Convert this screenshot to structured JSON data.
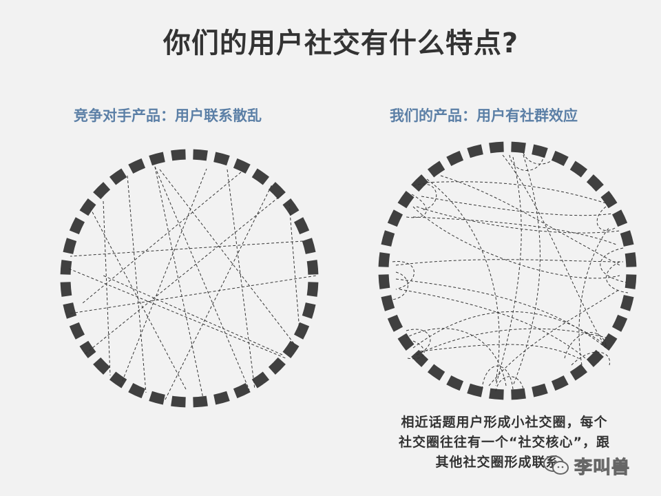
{
  "title": "你们的用户社交有什么特点?",
  "left": {
    "heading": "竞争对手产品：用户联系散乱"
  },
  "right": {
    "heading": "我们的产品：用户有社群效应",
    "caption": "相近话题用户形成小社交圈，每个社交圈往往有一个“社交核心”，跟其他社交圈形成联系。"
  },
  "watermark": {
    "text": "李叫兽",
    "icon": "wechat-icon"
  },
  "colors": {
    "background": "#f2f2f2",
    "title": "#333333",
    "heading": "#5b7fa6",
    "ring": "#404040",
    "line": "#333333"
  }
}
